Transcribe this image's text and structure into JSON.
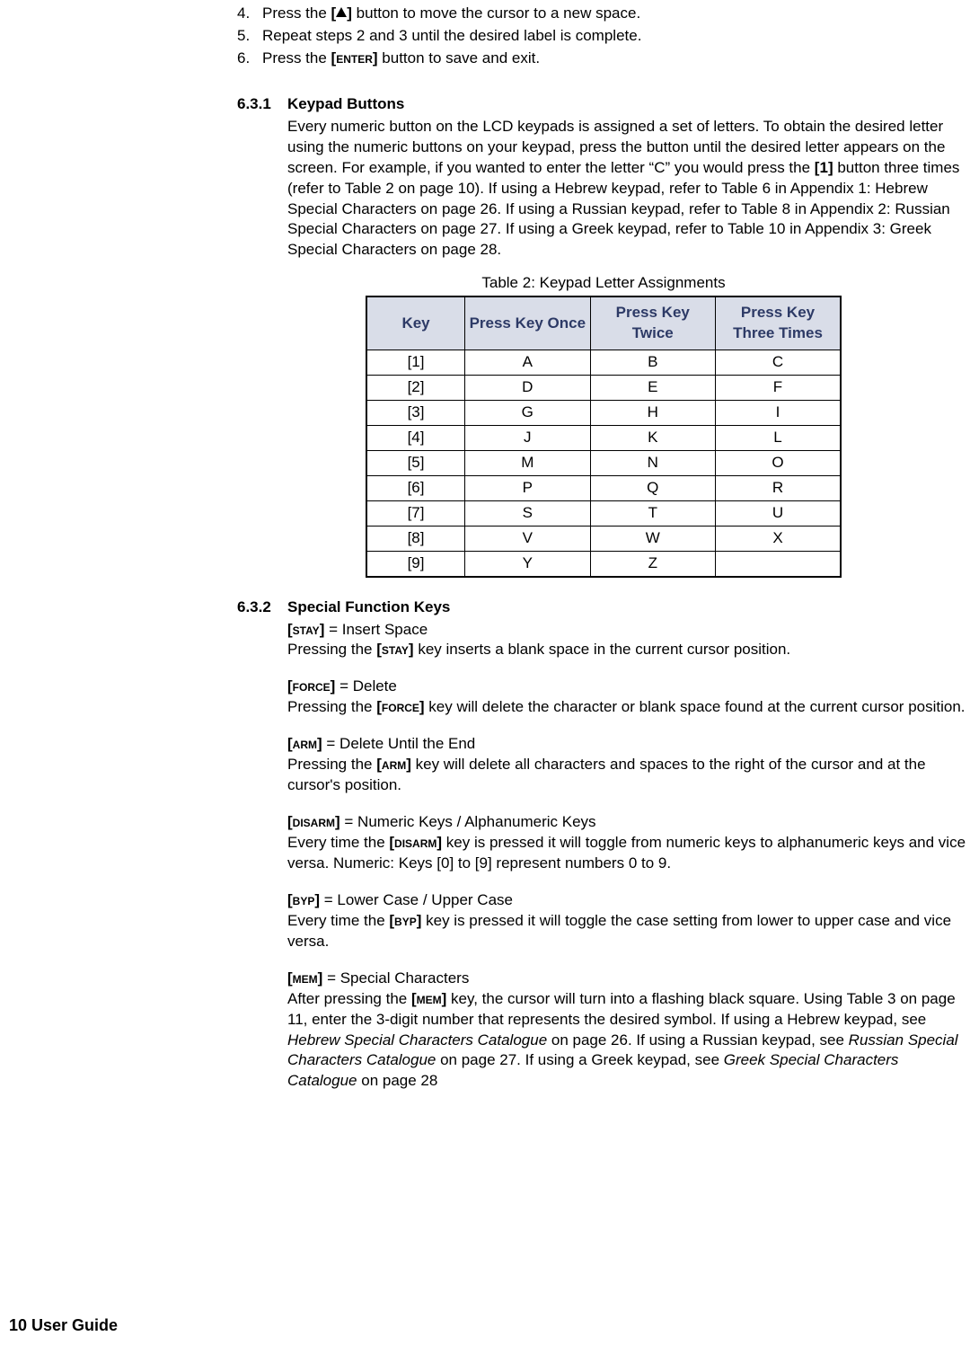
{
  "steps": [
    {
      "num": "4.",
      "pre": "Press the ",
      "key": "[▲]",
      "post": " button to move the cursor to a new space."
    },
    {
      "num": "5.",
      "pre": "Repeat steps 2 and 3 until the desired label is complete.",
      "key": "",
      "post": ""
    },
    {
      "num": "6.",
      "pre": "Press the ",
      "key": "[ENTER]",
      "post": " button to save and exit."
    }
  ],
  "sec631": {
    "number": "6.3.1",
    "title": "Keypad Buttons",
    "body_pre": "Every numeric button on the LCD keypads is assigned a set of letters. To obtain the desired letter using the numeric buttons on your keypad, press the button until the desired letter appears on the screen. For example, if you wanted to enter the letter “C” you would press the ",
    "body_key": "[1]",
    "body_post": " button three times (refer to Table 2 on page 10). If using a Hebrew keypad, refer to Table 6 in Appendix 1: Hebrew Special Characters on page 26. If using a Russian keypad, refer to Table 8 in Appendix 2: Russian Special Characters on page 27. If using a Greek keypad, refer to Table 10 in Appendix 3: Greek Special Characters on page 28."
  },
  "table": {
    "caption": "Table 2: Keypad Letter Assignments",
    "headers": [
      "Key",
      "Press Key Once",
      "Press Key Twice",
      "Press Key Three Times"
    ],
    "rows": [
      [
        "[1]",
        "A",
        "B",
        "C"
      ],
      [
        "[2]",
        "D",
        "E",
        "F"
      ],
      [
        "[3]",
        "G",
        "H",
        "I"
      ],
      [
        "[4]",
        "J",
        "K",
        "L"
      ],
      [
        "[5]",
        "M",
        "N",
        "O"
      ],
      [
        "[6]",
        "P",
        "Q",
        "R"
      ],
      [
        "[7]",
        "S",
        "T",
        "U"
      ],
      [
        "[8]",
        "V",
        "W",
        "X"
      ],
      [
        "[9]",
        "Y",
        "Z",
        ""
      ]
    ]
  },
  "sec632": {
    "number": "6.3.2",
    "title": "Special Function Keys",
    "items": [
      {
        "key": "[STAY]",
        "eq": " = Insert Space",
        "desc_pre": "Pressing the ",
        "desc_key": "[STAY]",
        "desc_post": " key inserts a blank space in the current cursor position."
      },
      {
        "key": "[FORCE]",
        "eq": " = Delete",
        "desc_pre": "Pressing the ",
        "desc_key": "[FORCE]",
        "desc_post": " key will delete the character or blank space found at the current cursor position."
      },
      {
        "key": "[ARM]",
        "eq": " = Delete Until the End",
        "desc_pre": "Pressing the ",
        "desc_key": "[ARM]",
        "desc_post": " key will delete all characters and spaces to the right of the cursor and at the cursor's position."
      },
      {
        "key": "[DISARM]",
        "eq": " = Numeric Keys / Alphanumeric Keys",
        "desc_pre": "Every time the ",
        "desc_key": "[DISARM]",
        "desc_post": " key is pressed it will toggle from numeric keys to alphanumeric keys and vice versa. Numeric: Keys [0] to [9] represent numbers 0 to 9."
      },
      {
        "key": "[BYP]",
        "eq": " = Lower Case / Upper Case",
        "desc_pre": "Every time the ",
        "desc_key": "[BYP]",
        "desc_post": " key is pressed it will toggle the case setting from lower to upper case and vice versa."
      }
    ],
    "mem": {
      "key": "[MEM]",
      "eq": " = Special Characters",
      "desc_pre": "After pressing the ",
      "desc_key": "[MEM]",
      "desc_mid1": " key, the cursor will turn into a flashing black square. Using Table 3 on page 11, enter the 3-digit number that represents the desired symbol. If using a Hebrew keypad, see ",
      "ital1": "Hebrew Special Characters Catalogue",
      "desc_mid2": " on page 26. If using a Russian keypad, see ",
      "ital2": "Russian Special Characters Catalogue",
      "desc_mid3": " on page 27. If using a Greek keypad, see ",
      "ital3": "Greek Special Characters Catalogue",
      "desc_post": " on page 28"
    }
  },
  "footer": "10 User Guide"
}
